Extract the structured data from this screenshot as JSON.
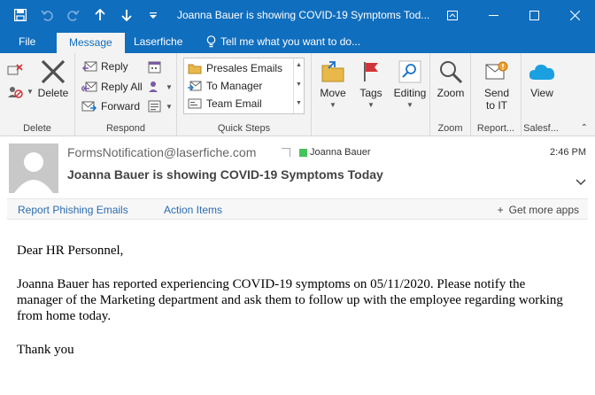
{
  "window": {
    "title": "Joanna Bauer is showing COVID-19 Symptoms Tod..."
  },
  "tabs": [
    {
      "label": "File"
    },
    {
      "label": "Message"
    },
    {
      "label": "Laserfiche"
    },
    {
      "label": "Tell me what you want to do..."
    }
  ],
  "ribbon": {
    "delete_group": {
      "delete_label": "Delete",
      "group_label": "Delete"
    },
    "respond_group": {
      "reply": "Reply",
      "reply_all": "Reply All",
      "forward": "Forward",
      "group_label": "Respond"
    },
    "quick_steps": {
      "items": [
        "Presales Emails",
        "To Manager",
        "Team Email"
      ],
      "group_label": "Quick Steps"
    },
    "move": {
      "label": "Move"
    },
    "tags": {
      "label": "Tags"
    },
    "editing": {
      "label": "Editing"
    },
    "zoom": {
      "label": "Zoom",
      "group_label": "Zoom"
    },
    "report": {
      "label_line1": "Send",
      "label_line2": "to IT",
      "group_label": "Report..."
    },
    "salesforce": {
      "label": "View",
      "group_label": "Salesf..."
    }
  },
  "message": {
    "from": "FormsNotification@laserfiche.com",
    "to": "Joanna Bauer",
    "time": "2:46 PM",
    "subject": "Joanna Bauer is showing COVID-19 Symptoms Today"
  },
  "addins": {
    "report_phishing": "Report Phishing Emails",
    "action_items": "Action Items",
    "get_more": "Get more apps"
  },
  "body": {
    "greeting": "Dear HR Personnel,",
    "paragraph": "Joanna Bauer has reported experiencing COVID-19 symptoms on 05/11/2020. Please notify the manager of the Marketing department and ask them to follow up with the employee regarding working from home today.",
    "signoff": "Thank you"
  },
  "colors": {
    "accent": "#106ebe",
    "ribbon_bg": "#f3f3f3",
    "link": "#2b6cb0",
    "to_flag": "#46c35a"
  }
}
